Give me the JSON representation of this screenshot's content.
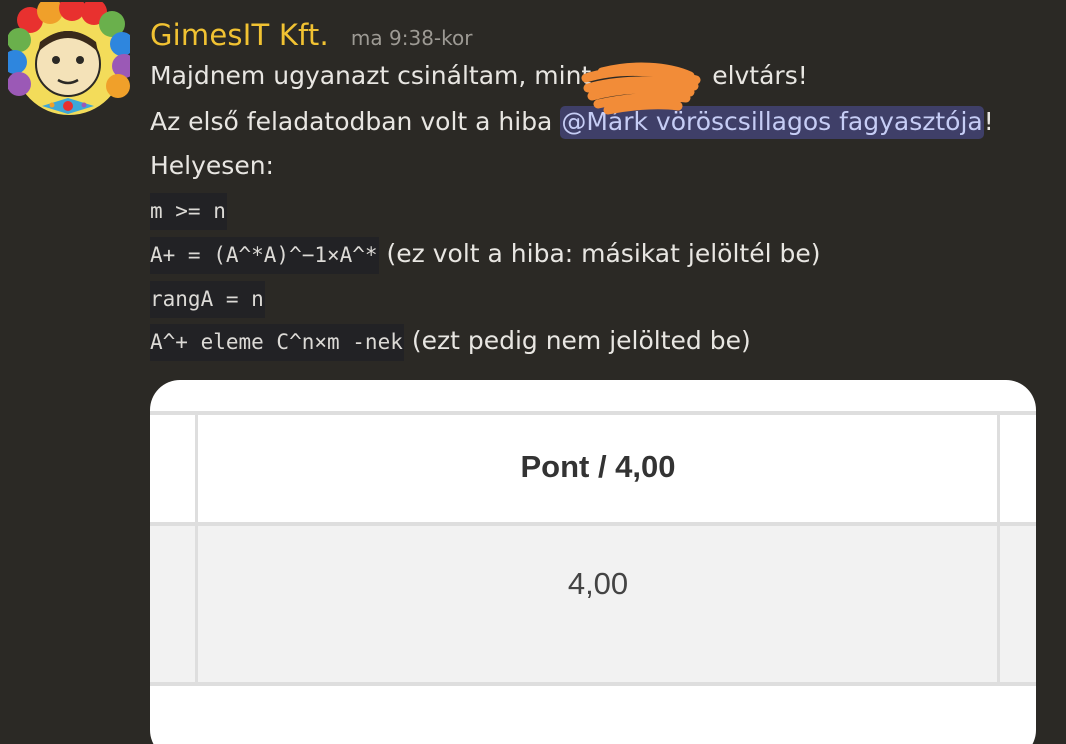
{
  "message": {
    "username": "GimesIT Kft.",
    "timestamp": "ma 9:38-kor",
    "avatar_icon": "clown-avatar-icon",
    "line1": "Majdnem ugyanazt csináltam, mint ",
    "line1_end": "elvtárs!",
    "line2_prefix": "Az első feladatodban volt a hiba ",
    "mention": "@Márk vöröscsillagos fagyasztója",
    "line2_suffix": "!",
    "line3": "Helyesen:",
    "code1": "m >= n",
    "code2": "A+ = (A^*A)^−1×A^*",
    "code2_note": " (ez volt a hiba: másikat jelöltél be)",
    "code3": "rangA = n",
    "code4": "A^+ eleme C^n×m -nek",
    "code4_note": " (ezt pedig nem jelölted be)"
  },
  "embed": {
    "header": "Pont / 4,00",
    "value": "4,00"
  },
  "colors": {
    "background": "#2b2925",
    "username": "#f1c232",
    "mention_bg": "#3f3f68",
    "mention_text": "#c6cdf5",
    "scribble": "#f28c38"
  }
}
